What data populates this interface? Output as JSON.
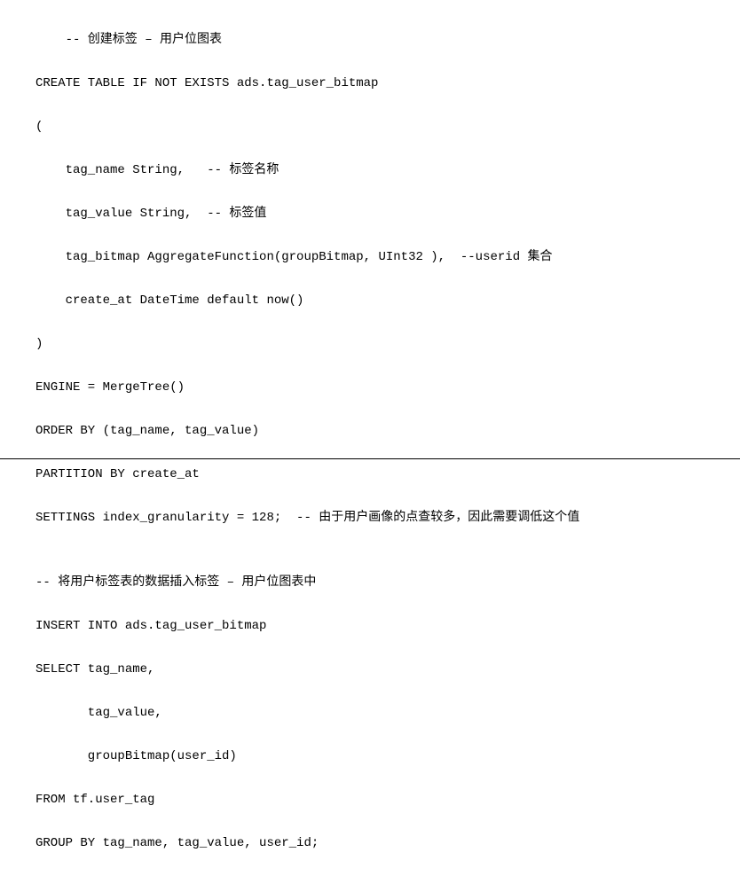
{
  "code": {
    "lines": [
      {
        "indent": "    ",
        "text": "-- 创建标签 – 用户位图表"
      },
      {
        "indent": "",
        "text": "CREATE TABLE IF NOT EXISTS ads.tag_user_bitmap"
      },
      {
        "indent": "",
        "text": "("
      },
      {
        "indent": "    ",
        "text": "tag_name String,   -- 标签名称"
      },
      {
        "indent": "    ",
        "text": "tag_value String,  -- 标签值"
      },
      {
        "indent": "    ",
        "text": "tag_bitmap AggregateFunction(groupBitmap, UInt32 ),  --userid 集合"
      },
      {
        "indent": "    ",
        "text": "create_at DateTime default now()"
      },
      {
        "indent": "",
        "text": ")"
      },
      {
        "indent": "",
        "text": "ENGINE = MergeTree()"
      },
      {
        "indent": "",
        "text": "ORDER BY (tag_name, tag_value)"
      },
      {
        "indent": "",
        "text": "PARTITION BY create_at"
      },
      {
        "indent": "",
        "text": "SETTINGS index_granularity = 128;  -- 由于用户画像的点查较多，因此需要调低这个值"
      },
      {
        "indent": "",
        "text": ""
      },
      {
        "indent": "",
        "text": "-- 将用户标签表的数据插入标签 – 用户位图表中"
      },
      {
        "indent": "",
        "text": "INSERT INTO ads.tag_user_bitmap"
      },
      {
        "indent": "",
        "text": "SELECT tag_name,"
      },
      {
        "indent": "       ",
        "text": "tag_value,"
      },
      {
        "indent": "       ",
        "text": "groupBitmap(user_id)"
      },
      {
        "indent": "",
        "text": "FROM tf.user_tag"
      },
      {
        "indent": "",
        "text": "GROUP BY tag_name, tag_value, user_id;"
      }
    ]
  }
}
